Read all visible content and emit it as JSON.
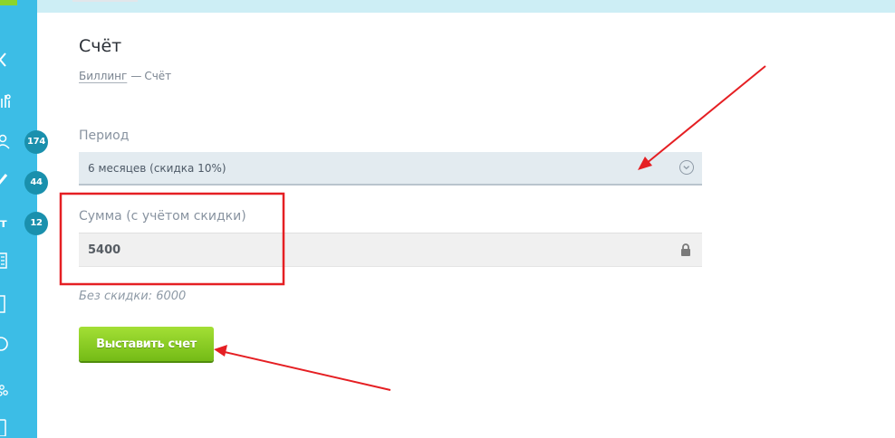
{
  "page": {
    "title": "Счёт",
    "breadcrumb": {
      "link": "Биллинг",
      "separator": "—",
      "current": "Счёт"
    }
  },
  "sidebar": {
    "badges": [
      {
        "count": "174"
      },
      {
        "count": "44"
      },
      {
        "count": "12"
      }
    ],
    "truncated_label": "т",
    "icons": [
      "close-icon",
      "chart-icon",
      "user-icon",
      "pencil-icon",
      "building-icon",
      "bar-icon",
      "circle-icon",
      "group-icon",
      "doc-icon"
    ]
  },
  "form": {
    "period": {
      "label": "Период",
      "value": "6 месяцев (скидка 10%)"
    },
    "sum": {
      "label": "Сумма (с учётом скидки)",
      "value": "5400"
    },
    "discount_note": "Без скидки: 6000",
    "submit_label": "Выставить счет"
  },
  "colors": {
    "sidebar": "#3cbde6",
    "badge": "#1a90ad",
    "button": "#85cc1d",
    "annotation": "#e51f23"
  }
}
